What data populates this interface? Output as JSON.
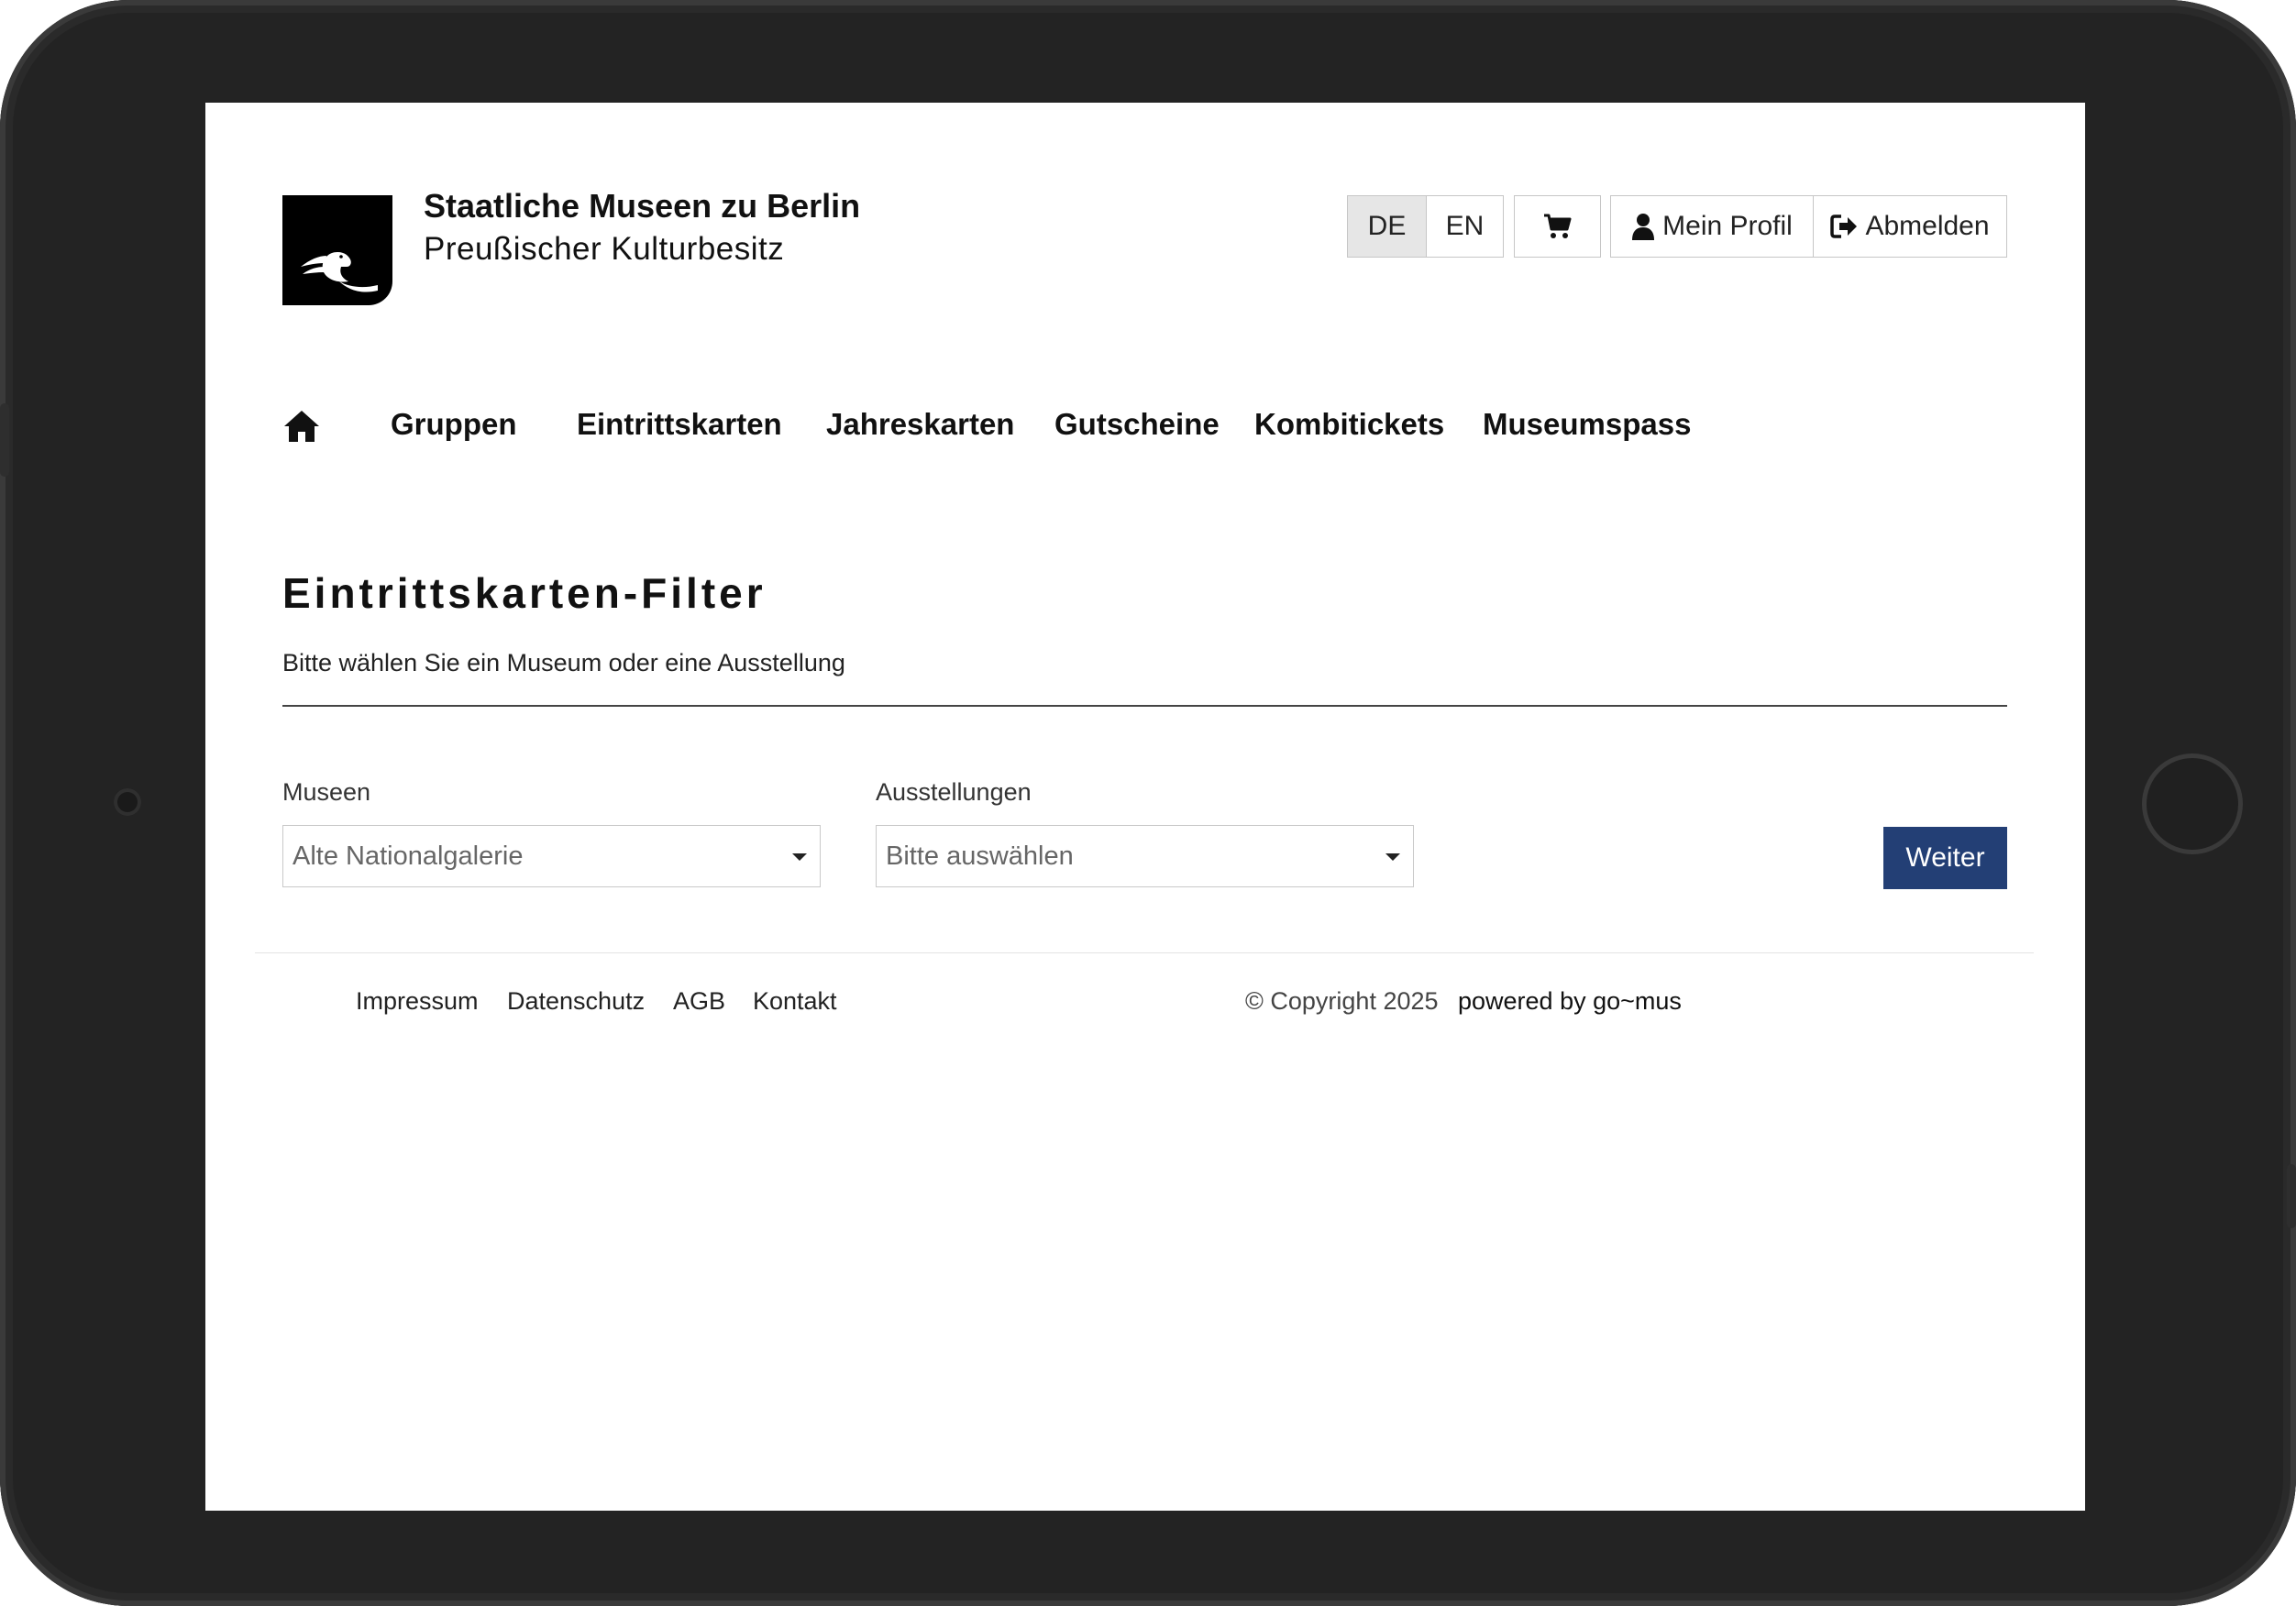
{
  "header": {
    "title": "Staatliche Museen zu Berlin",
    "subtitle": "Preußischer Kulturbesitz",
    "lang_de": "DE",
    "lang_en": "EN",
    "active_lang": "DE",
    "profile_label": "Mein Profil",
    "logout_label": "Abmelden"
  },
  "nav": {
    "items": [
      {
        "label": "Gruppen"
      },
      {
        "label": "Eintrittskarten"
      },
      {
        "label": "Jahreskarten"
      },
      {
        "label": "Gutscheine"
      },
      {
        "label": "Kombitickets"
      },
      {
        "label": "Museumspass"
      }
    ]
  },
  "main": {
    "title": "Eintrittskarten-Filter",
    "subtitle": "Bitte wählen Sie ein Museum oder eine Ausstellung",
    "museums_label": "Museen",
    "museums_value": "Alte Nationalgalerie",
    "exhibitions_label": "Ausstellungen",
    "exhibitions_value": "Bitte auswählen",
    "submit_label": "Weiter"
  },
  "footer": {
    "links": [
      {
        "label": "Impressum"
      },
      {
        "label": "Datenschutz"
      },
      {
        "label": "AGB"
      },
      {
        "label": "Kontakt"
      }
    ],
    "copyright": "© Copyright 2025",
    "powered": "powered by go~mus"
  },
  "colors": {
    "primary_button": "#233f75",
    "device_frame": "#232323",
    "active_lang_bg": "#e6e6e6"
  },
  "icons": [
    "eagle-logo-icon",
    "cart-icon",
    "user-icon",
    "logout-icon",
    "home-icon",
    "caret-down-icon"
  ]
}
